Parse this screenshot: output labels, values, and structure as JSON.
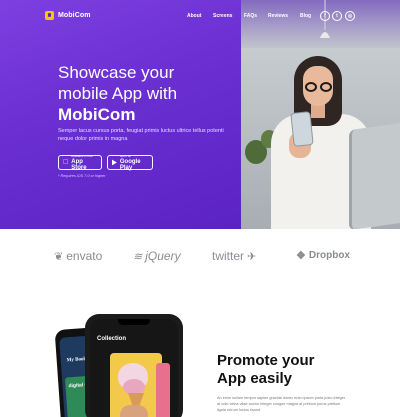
{
  "nav": {
    "brand": "MobiCom",
    "links": [
      "About",
      "Screens",
      "FAQs",
      "Reviews",
      "Blog"
    ],
    "social": [
      {
        "name": "facebook-icon",
        "glyph": "f"
      },
      {
        "name": "twitter-icon",
        "glyph": "t"
      },
      {
        "name": "instagram-icon",
        "glyph": "◎"
      }
    ]
  },
  "hero": {
    "title_line1": "Showcase your",
    "title_line2": "mobile App with",
    "title_brand": "MobiCom",
    "description": "Semper lacus cursus porta, feugiat primis luctus ultrice tellus potenti neque dolor primis in magna",
    "app_store": {
      "small": "Available on the",
      "big": "App Store"
    },
    "google_play": {
      "small": "Get it on",
      "big": "Google Play"
    },
    "note": "* Requires iOS 7.0 or higher",
    "gradient_colors": [
      "#7d3fe0",
      "#5b22c4"
    ]
  },
  "partners": [
    {
      "name": "envato",
      "glyph": "❦"
    },
    {
      "name": "jQuery",
      "glyph": "≋"
    },
    {
      "name": "twitter",
      "glyph": "✈"
    },
    {
      "name": "Dropbox",
      "glyph": "❖"
    }
  ],
  "phones": {
    "front_title": "Collection",
    "back_title": "My Book",
    "back_tile_text": "digital growth"
  },
  "promo": {
    "title_line1": "Promote your",
    "title_line2": "App easily",
    "text": "An enim nullam tempor sapien gravida donec enim ipsum porta justo integer at odio velna vitae auctor integer congue magna at pretium purus pretium ligula rutrum luctus risusd"
  }
}
